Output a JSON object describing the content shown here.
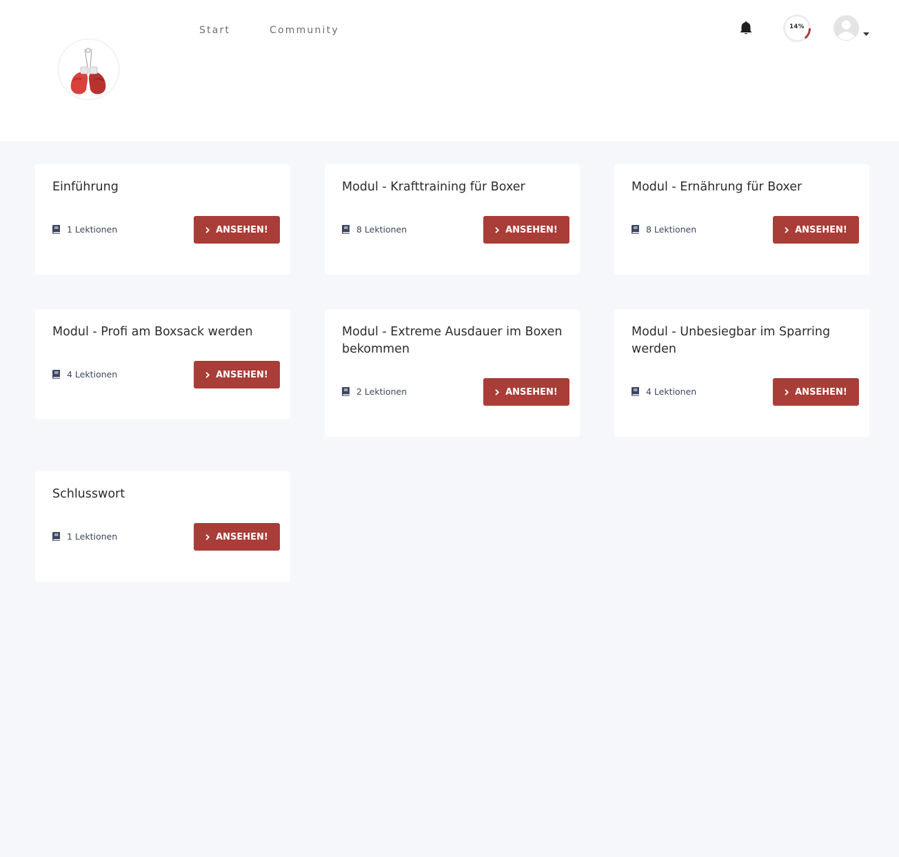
{
  "nav": {
    "links": [
      {
        "label": "Start"
      },
      {
        "label": "Community"
      }
    ]
  },
  "user": {
    "progress_text": "14%",
    "progress_fraction": 0.14
  },
  "icons": {
    "logo": "boxing-gloves-icon",
    "notifications": "bell-icon",
    "avatar": "user-avatar-icon",
    "dropdown": "caret-down-icon",
    "lessons": "book-icon",
    "button": "chevron-right-icon"
  },
  "colors": {
    "accent": "#a93d37",
    "page_background": "#f6f7fb",
    "lesson_text": "#3c4660"
  },
  "modules": [
    {
      "title": "Einführung",
      "lessons": "1 Lektionen",
      "button": "ANSEHEN!"
    },
    {
      "title": "Modul - Krafttraining für Boxer",
      "lessons": "8 Lektionen",
      "button": "ANSEHEN!"
    },
    {
      "title": "Modul - Ernährung für Boxer",
      "lessons": "8 Lektionen",
      "button": "ANSEHEN!"
    },
    {
      "title": "Modul - Profi am Boxsack werden",
      "lessons": "4 Lektionen",
      "button": "ANSEHEN!"
    },
    {
      "title": "Modul - Extreme Ausdauer im Boxen bekommen",
      "lessons": "2 Lektionen",
      "button": "ANSEHEN!"
    },
    {
      "title": "Modul - Unbesiegbar im Sparring werden",
      "lessons": "4 Lektionen",
      "button": "ANSEHEN!"
    },
    {
      "title": "Schlusswort",
      "lessons": "1 Lektionen",
      "button": "ANSEHEN!"
    }
  ]
}
